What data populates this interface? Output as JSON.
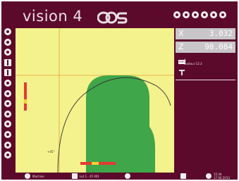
{
  "app": {
    "title": "vision 4",
    "logo_text": "OCS"
  },
  "colors": {
    "background": "#5c0a2c",
    "canvas": "#f4f28c",
    "shape": "#3fa64a",
    "guide": "#e0a33a",
    "readout": "#c8c6c8"
  },
  "top_icons": [
    "circle-icon",
    "circle-icon",
    "gear-icon",
    "search-icon",
    "globe-icon",
    "help-icon"
  ],
  "left_icons": [
    "close-circle-icon",
    "settings-circle-icon",
    "record-circle-icon",
    "grid-icon",
    "document-icon",
    "minus-circle-icon",
    "rewind-circle-icon",
    "check-circle-icon",
    "camera-circle-icon",
    "info-circle-icon",
    "person-circle-icon",
    "circle-icon",
    "refresh-circle-icon"
  ],
  "readouts": {
    "x_label": "X",
    "x_value": "3.032",
    "z_label": "Z",
    "z_value": "98.084"
  },
  "info": {
    "badge": "mm",
    "line1": "0",
    "line2": "contour 12.3"
  },
  "canvas": {
    "angle_label": "+45°"
  },
  "status_bar": {
    "item1": "Machine",
    "item2": "Lot 1 - 25 001",
    "time": "15:34",
    "date": "17.06.2013"
  }
}
